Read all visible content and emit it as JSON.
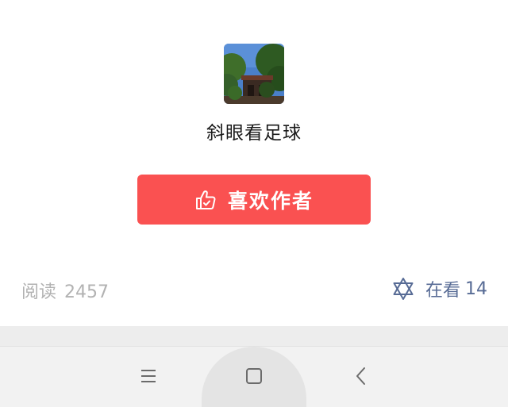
{
  "author": {
    "name": "斜眼看足球",
    "avatar_icon": "landscape-photo-avatar"
  },
  "like_button": {
    "label": "喜欢作者",
    "icon": "thumbs-up-icon",
    "color": "#fa5151"
  },
  "stats": {
    "reads_label": "阅读",
    "reads_count": "2457",
    "watching_label": "在看",
    "watching_count": "14",
    "watching_icon": "star-of-david-icon",
    "link_color": "#576b95"
  },
  "navbar": {
    "menu_icon": "menu-icon",
    "home_icon": "home-square-icon",
    "back_icon": "back-chevron-icon"
  }
}
